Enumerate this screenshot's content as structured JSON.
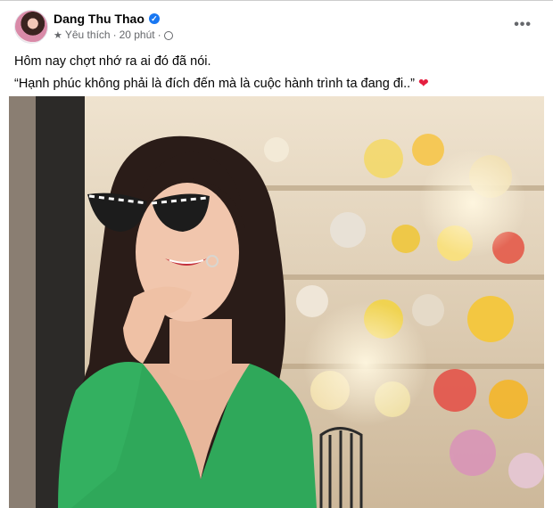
{
  "post": {
    "author": "Dang Thu Thao",
    "verified_icon": "verified-badge-icon",
    "meta": {
      "star_icon": "star-icon",
      "label": "Yêu thích",
      "separator": "·",
      "time": "20 phút",
      "audience_icon": "globe-icon"
    },
    "more_icon": "more-options-icon",
    "more_label": "•••",
    "text_line1": "Hôm nay chợt nhớ ra ai đó đã nói.",
    "text_line2": "“Hạnh phúc không phải là đích đến mà là cuộc hành trình ta đang đi..”",
    "heart": "❤"
  },
  "colors": {
    "link_blue": "#1877f2",
    "meta_gray": "#65676b",
    "dress_green": "#2fa85a",
    "heart_red": "#e41e3f"
  }
}
